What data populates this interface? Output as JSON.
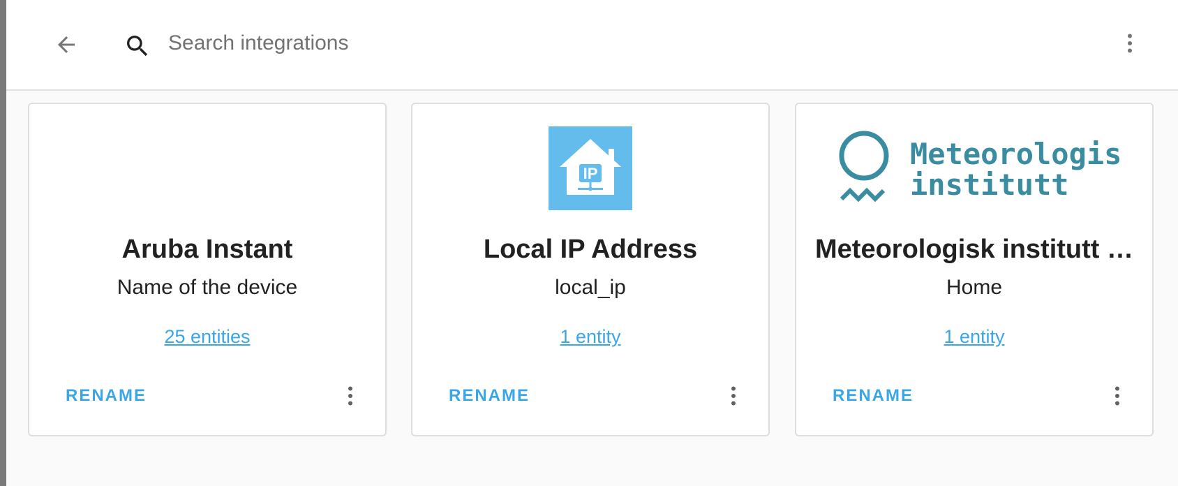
{
  "search": {
    "placeholder": "Search integrations"
  },
  "icons": {
    "back": "arrow-left-icon",
    "search": "magnify-icon",
    "header_menu": "dots-vertical-icon",
    "card_menu": "dots-vertical-icon"
  },
  "colors": {
    "accent": "#3aa6e8",
    "local_ip_logo_bg": "#64bced",
    "met_logo": "#3a8da0"
  },
  "cards": [
    {
      "title": "Aruba Instant",
      "subtitle": "Name of the device",
      "entities": "25 entities",
      "rename": "RENAME"
    },
    {
      "title": "Local IP Address",
      "subtitle": "local_ip",
      "entities": "1 entity",
      "rename": "RENAME",
      "logo_text": "IP"
    },
    {
      "title": "Meteorologisk institutt …",
      "subtitle": "Home",
      "entities": "1 entity",
      "rename": "RENAME",
      "logo_line1": "Meteorologisk",
      "logo_line2": "institutt"
    }
  ]
}
